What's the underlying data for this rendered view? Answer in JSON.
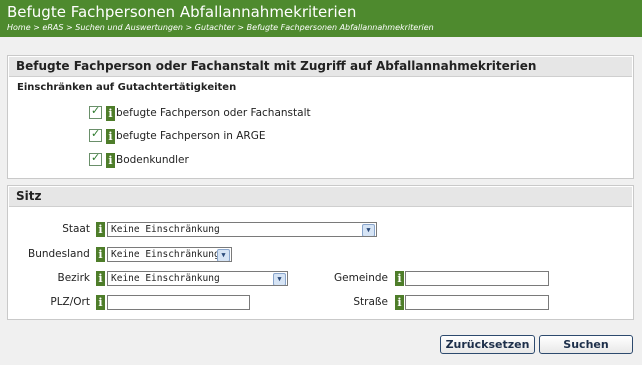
{
  "header": {
    "title": "Befugte Fachpersonen Abfallannahmekriterien",
    "breadcrumb": "Home > eRAS > Suchen und Auswertungen > Gutachter > Befugte Fachpersonen Abfallannahmekriterien"
  },
  "panel1": {
    "title": "Befugte Fachperson oder Fachanstalt mit Zugriff auf Abfallannahmekriterien",
    "subheading": "Einschränken auf Gutachtertätigkeiten",
    "options": [
      {
        "label": "befugte Fachperson oder Fachanstalt",
        "checked": true
      },
      {
        "label": "befugte Fachperson in ARGE",
        "checked": true
      },
      {
        "label": "Bodenkundler",
        "checked": true
      }
    ]
  },
  "panel2": {
    "title": "Sitz",
    "staat": {
      "label": "Staat",
      "value": "Keine Einschränkung"
    },
    "bundesland": {
      "label": "Bundesland",
      "value": "Keine Einschränkung"
    },
    "bezirk": {
      "label": "Bezirk",
      "value": "Keine Einschränkung"
    },
    "gemeinde": {
      "label": "Gemeinde",
      "value": ""
    },
    "plzort": {
      "label": "PLZ/Ort",
      "value": ""
    },
    "strasse": {
      "label": "Straße",
      "value": ""
    }
  },
  "buttons": {
    "reset": "Zurücksetzen",
    "search": "Suchen"
  },
  "info_glyph": "i",
  "colors": {
    "header_bg": "#4e8a2e",
    "info_icon": "#4e7d2a",
    "panel_head": "#e6e6e6"
  }
}
